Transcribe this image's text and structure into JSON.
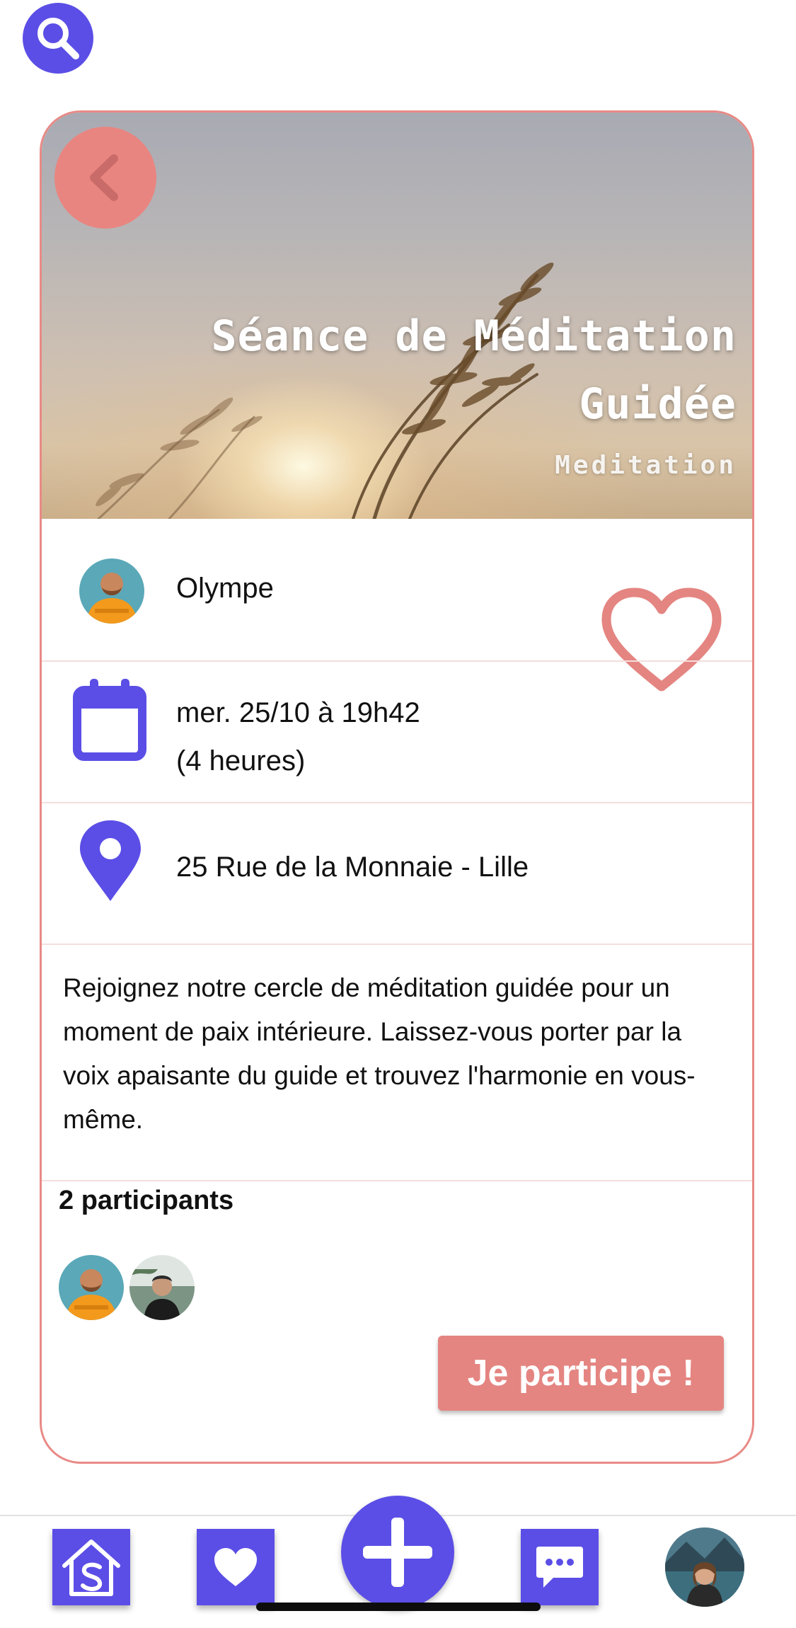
{
  "colors": {
    "accent": "#5b4ee6",
    "brand_salmon": "#e48581",
    "card_border": "#e88a86"
  },
  "icons": {
    "search": "search-icon",
    "back": "chevron-left-icon",
    "favorite": "heart-outline-icon",
    "calendar": "calendar-icon",
    "location": "map-pin-icon",
    "home": "home-icon",
    "favorites_tab": "heart-icon",
    "add": "plus-icon",
    "messages": "chat-bubble-icon"
  },
  "event": {
    "title_line1": "Séance de Méditation",
    "title_line2": "Guidée",
    "category": "Meditation",
    "organizer": "Olympe",
    "date_line1": "mer. 25/10 à 19h42",
    "date_line2": "(4 heures)",
    "location": "25 Rue de la Monnaie - Lille",
    "description": "Rejoignez notre cercle de méditation guidée pour un moment de paix intérieure. Laissez-vous porter par la voix apaisante du guide et trouvez l'harmonie en vous-même."
  },
  "participants": {
    "title": "2 participants",
    "count": 2
  },
  "join_button_label": "Je participe !"
}
